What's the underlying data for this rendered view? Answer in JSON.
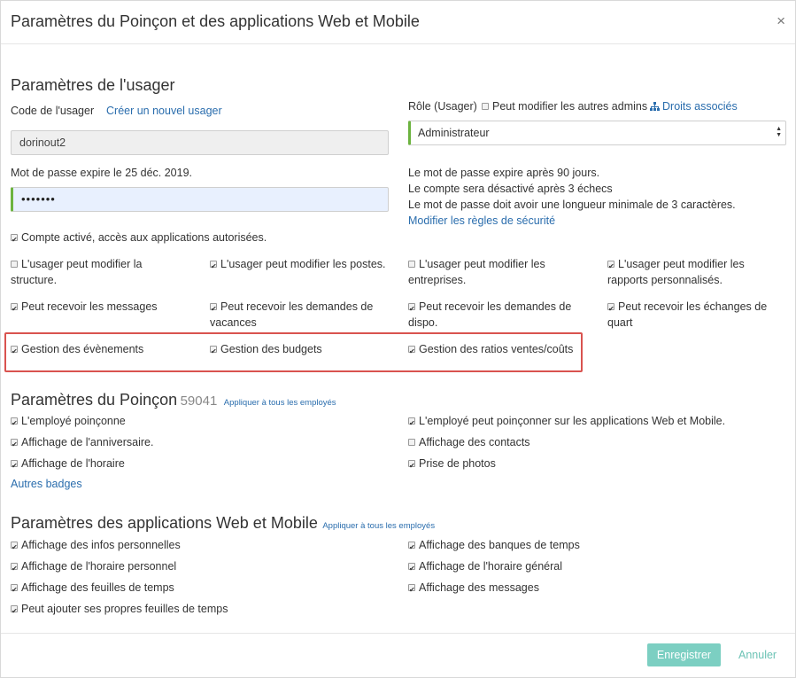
{
  "modal": {
    "title": "Paramètres du Poinçon et des applications Web et Mobile",
    "close": "×"
  },
  "user": {
    "section_title": "Paramètres de l'usager",
    "code_label": "Code de l'usager",
    "create_link": "Créer un nouvel usager",
    "code_value": "dorinout2",
    "password_expiry": "Mot de passe expire le 25 déc. 2019.",
    "password_value": "•••••••",
    "role_label": "Rôle (Usager)",
    "can_modify_admins": "Peut modifier les autres admins",
    "rights_link": "Droits associés",
    "role_value": "Administrateur",
    "policy_lines": [
      "Le mot de passe expire après 90 jours.",
      "Le compte sera désactivé après 3 échecs",
      "Le mot de passe doit avoir une longueur minimale de 3 caractères."
    ],
    "security_link": "Modifier les règles de sécurité",
    "account_active": "Compte activé, accès aux applications autorisées.",
    "permissions": [
      "L'usager peut modifier la structure.",
      "L'usager peut modifier les postes.",
      "L'usager peut modifier les entreprises.",
      "L'usager peut modifier les rapports personnalisés.",
      "Peut recevoir les messages",
      "Peut recevoir les demandes de vacances",
      "Peut recevoir les demandes de dispo.",
      "Peut recevoir les échanges de quart",
      "Gestion des évènements",
      "Gestion des budgets",
      "Gestion des ratios ventes/coûts"
    ]
  },
  "punch": {
    "section_title": "Paramètres du Poinçon",
    "number": "59041",
    "apply_all": "Appliquer à tous les employés",
    "left": [
      "L'employé poinçonne",
      "Affichage de l'anniversaire.",
      "Affichage de l'horaire"
    ],
    "right": [
      "L'employé peut poinçonner sur les applications Web et Mobile.",
      "Affichage des contacts",
      "Prise de photos"
    ],
    "other_badges": "Autres badges"
  },
  "apps": {
    "section_title": "Paramètres des applications Web et Mobile",
    "apply_all": "Appliquer à tous les employés",
    "left": [
      "Affichage des infos personnelles",
      "Affichage de l'horaire personnel",
      "Affichage des feuilles de temps",
      "Peut ajouter ses propres feuilles de temps"
    ],
    "right": [
      "Affichage des banques de temps",
      "Affichage de l'horaire général",
      "Affichage des messages"
    ]
  },
  "footer": {
    "save": "Enregistrer",
    "cancel": "Annuler"
  },
  "colors": {
    "accent_green": "#6cb33f",
    "link_blue": "#2a6dad",
    "save_button": "#7ccfc2",
    "highlight_red": "#d9534f"
  }
}
